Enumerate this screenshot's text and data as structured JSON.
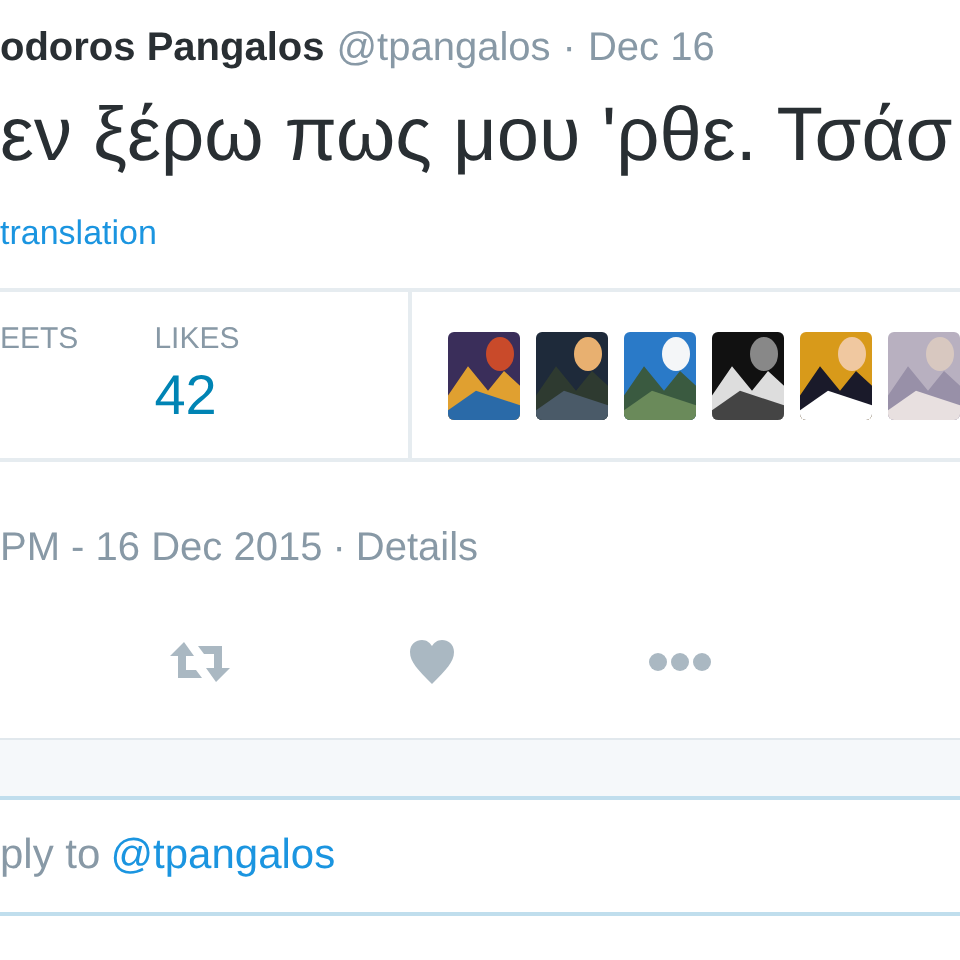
{
  "header": {
    "name": "odoros Pangalos",
    "handle": "@tpangalos",
    "separator": "·",
    "date": "Dec 16"
  },
  "tweet": {
    "text": "εν ξέρω πως μου 'ρθε. Τσάσ",
    "translation_link": "translation"
  },
  "stats": [
    {
      "label": "EETS"
    },
    {
      "label": "LIKES",
      "value": "42"
    }
  ],
  "timestamp": {
    "text": "PM - 16 Dec 2015",
    "separator": "·",
    "details_link": "Details"
  },
  "reply": {
    "prefix": "ply to",
    "mention": "@tpangalos"
  }
}
